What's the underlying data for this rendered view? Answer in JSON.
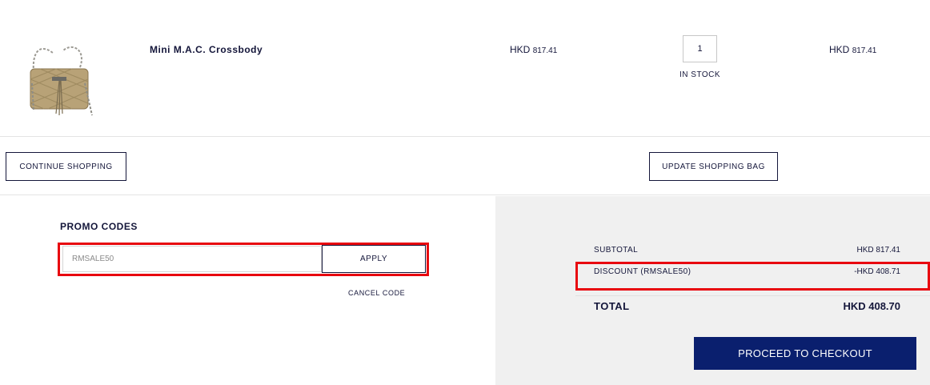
{
  "product": {
    "name": "Mini M.A.C. Crossbody",
    "unit_price_currency": "HKD",
    "unit_price_amount": "817.41",
    "quantity": "1",
    "stock_status": "IN STOCK",
    "total_currency": "HKD",
    "total_amount": "817.41",
    "image_icon": "crossbody-bag-image"
  },
  "actions": {
    "continue_label": "CONTINUE SHOPPING",
    "update_label": "UPDATE SHOPPING BAG"
  },
  "promo": {
    "title": "PROMO CODES",
    "input_value": "RMSALE50",
    "apply_label": "APPLY",
    "cancel_label": "CANCEL CODE"
  },
  "summary": {
    "subtotal_label": "SUBTOTAL",
    "subtotal_value": "HKD 817.41",
    "discount_label": "DISCOUNT (RMSALE50)",
    "discount_value": "-HKD 408.71",
    "total_label": "TOTAL",
    "total_value": "HKD 408.70",
    "checkout_label": "PROCEED TO CHECKOUT"
  },
  "colors": {
    "navy": "#14163a",
    "checkout_bg": "#0a1f6e",
    "highlight_red": "#e8070f",
    "summary_bg": "#f0f0f0"
  }
}
